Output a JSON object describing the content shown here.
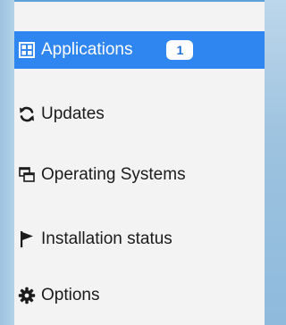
{
  "nav": {
    "items": [
      {
        "label": "Applications",
        "icon": "applications-icon",
        "active": true,
        "badge": "1"
      },
      {
        "label": "Updates",
        "icon": "refresh-icon",
        "active": false
      },
      {
        "label": "Operating Systems",
        "icon": "windows-icon",
        "active": false
      },
      {
        "label": "Installation status",
        "icon": "flag-icon",
        "active": false
      },
      {
        "label": "Options",
        "icon": "gear-icon",
        "active": false
      }
    ]
  },
  "colors": {
    "active_bg": "#2f86f0",
    "active_text": "#ffffff",
    "panel_bg": "#f3f3f3",
    "badge_text": "#1f6fd1"
  }
}
